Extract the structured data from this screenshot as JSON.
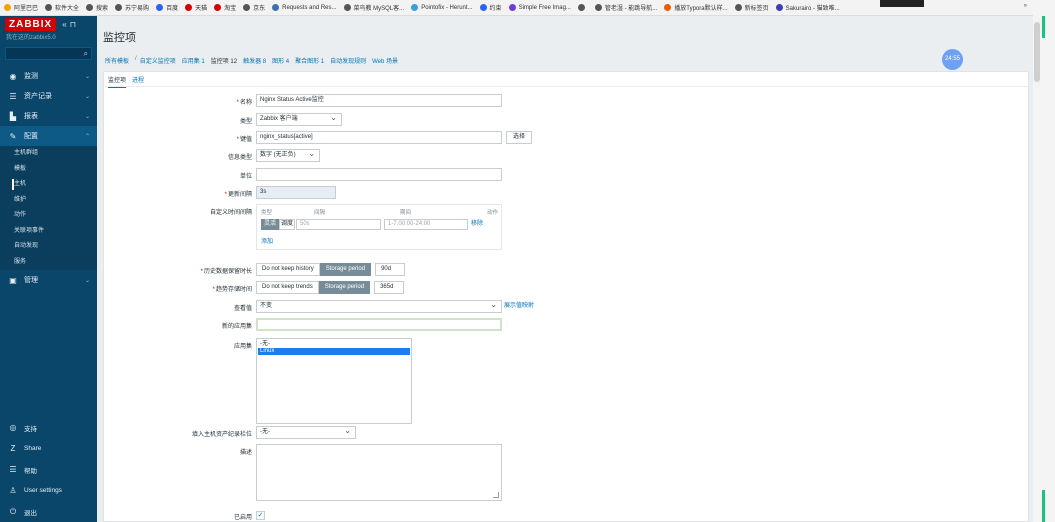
{
  "bookmarks": [
    {
      "label": "阿里巴巴",
      "color": "#f2a300"
    },
    {
      "label": "软件大全",
      "color": "#555555"
    },
    {
      "label": "搜索",
      "color": "#555555"
    },
    {
      "label": "苏宁易购",
      "color": "#555555"
    },
    {
      "label": "百度",
      "color": "#2a64f4"
    },
    {
      "label": "天猫",
      "color": "#d40000"
    },
    {
      "label": "淘宝",
      "color": "#d40000"
    },
    {
      "label": "京东",
      "color": "#555555"
    },
    {
      "label": "Requests and Res...",
      "color": "#3d6fb4"
    },
    {
      "label": "菜鸟教 MySQL客...",
      "color": "#555555"
    },
    {
      "label": "Pointofix - Herunt...",
      "color": "#3aa0d8"
    },
    {
      "label": "约束",
      "color": "#2a64f4"
    },
    {
      "label": "Simple Free Imag...",
      "color": "#6b3fd6"
    },
    {
      "label": "",
      "color": "#555555"
    },
    {
      "label": "管老湿 - 能跳导航...",
      "color": "#555555"
    },
    {
      "label": "播放Typora默认样...",
      "color": "#e85d00"
    },
    {
      "label": "新标签页",
      "color": "#555555"
    },
    {
      "label": "Sakurairo - 猫致唯...",
      "color": "#3b3fb4"
    }
  ],
  "bookmarks_more": "»",
  "sidebar": {
    "logo": "ZABBIX",
    "collapse_glyph": "«",
    "kiosk_glyph": "⊓",
    "server_name": "我在这的zabbix5.0",
    "search_icon_glyph": "⌕",
    "nav": [
      {
        "label": "监测",
        "icon": "◉"
      },
      {
        "label": "资产记录",
        "icon": "☰"
      },
      {
        "label": "报表",
        "icon": "▙"
      },
      {
        "label": "配置",
        "icon": "✎"
      }
    ],
    "config_sub": [
      "主机群组",
      "模板",
      "主机",
      "维护",
      "动作",
      "关联项事件",
      "自动发现",
      "服务"
    ],
    "admin": {
      "label": "管理",
      "icon": "▣"
    },
    "bottom": [
      {
        "label": "支持",
        "icon": "◎"
      },
      {
        "label": "Share",
        "icon": "Z"
      },
      {
        "label": "帮助",
        "icon": "☰"
      },
      {
        "label": "User settings",
        "icon": "♙"
      },
      {
        "label": "退出",
        "icon": "⏻"
      }
    ]
  },
  "main": {
    "title": "监控项",
    "timer": "24:55",
    "breadcrumb": [
      "所有模板",
      "自定义监控项",
      "应用集 1",
      "监控项 12",
      "触发器 8",
      "图形 4",
      "聚合图形 1",
      "自动发现规则",
      "Web 场景"
    ],
    "tabs": [
      "监控项",
      "进程"
    ]
  },
  "form": {
    "name_label": "名称",
    "name_value": "Nginx Status Active监控",
    "type_label": "类型",
    "type_value": "Zabbix 客户端",
    "key_label": "键值",
    "key_value": "nginx_status[active]",
    "key_select": "选择",
    "info_type_label": "信息类型",
    "info_type_value": "数字 (无正负)",
    "units_label": "单位",
    "units_value": "",
    "interval_label": "更新间隔",
    "interval_value": "3s",
    "custom_label": "自定义时间间隔",
    "custom_head_type": "类型",
    "custom_head_interval": "间隔",
    "custom_head_period": "期间",
    "custom_head_action": "动作",
    "custom_flexible": "灵活",
    "custom_scheduling": "调度",
    "custom_interval_placeholder": "50s",
    "custom_period_placeholder": "1-7,00:00-24:00",
    "custom_remove": "移除",
    "custom_add": "添加",
    "history_label": "历史数据保留时长",
    "history_nokeep": "Do not keep history",
    "history_period": "Storage period",
    "history_value": "90d",
    "trends_label": "趋势存储时间",
    "trends_nokeep": "Do not keep trends",
    "trends_period": "Storage period",
    "trends_value": "365d",
    "valuemap_label": "查看值",
    "valuemap_value": "不变",
    "valuemap_link": "展示值映射",
    "newapp_label": "新的应用集",
    "newapp_value": "",
    "apps_label": "应用集",
    "apps_options": [
      "-无-",
      "Linux"
    ],
    "apps_selected": "Linux",
    "inventory_label": "填入主机资产纪录栏位",
    "inventory_value": "-无-",
    "desc_label": "描述",
    "enabled_label": "已启用",
    "enabled_check": "✓"
  }
}
